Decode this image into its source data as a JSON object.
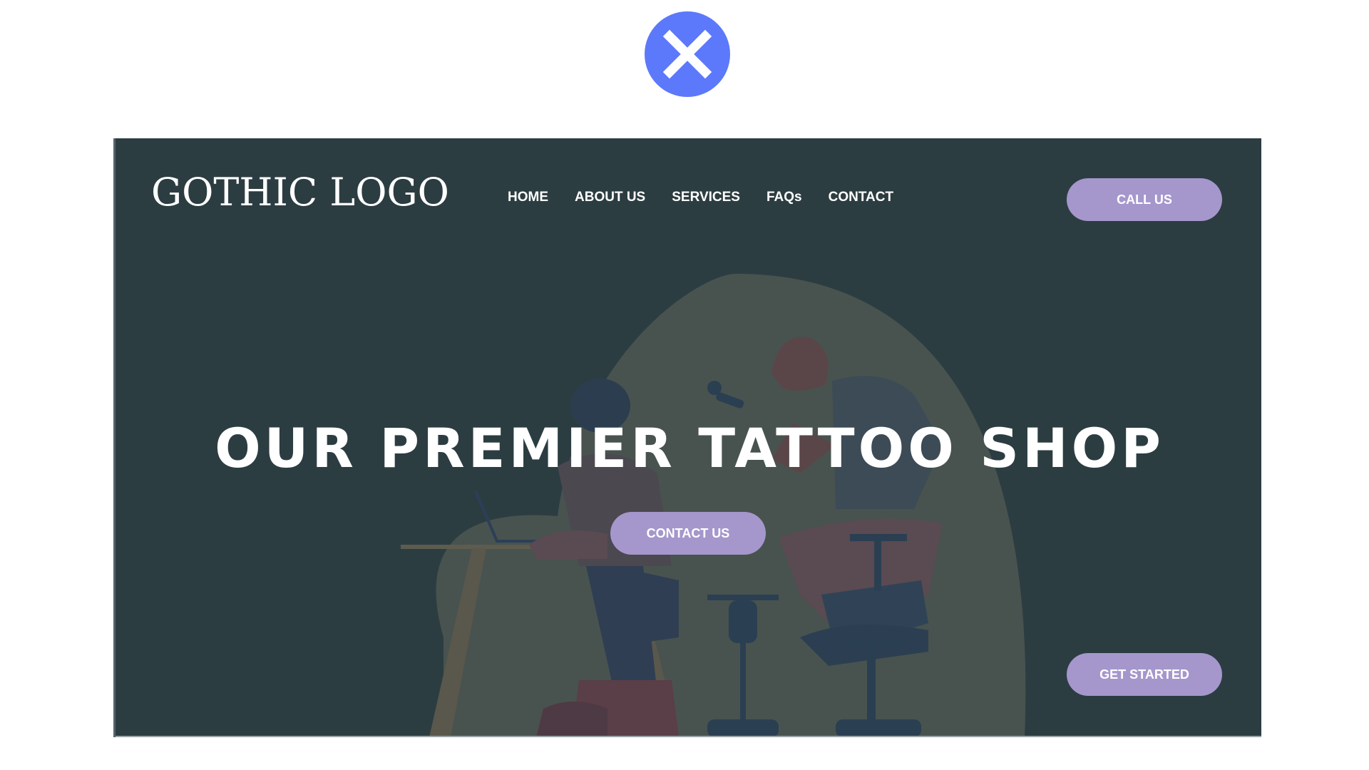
{
  "modal": {
    "close_icon": "close-icon",
    "close_color": "#5c79fb"
  },
  "site": {
    "logo": "GOTHIC LOGO",
    "nav": [
      "HOME",
      "ABOUT US",
      "SERVICES",
      "FAQs",
      "CONTACT"
    ],
    "call_label": "CALL US",
    "headline": "OUR PREMIER TATTOO SHOP",
    "contact_label": "CONTACT US",
    "start_label": "GET STARTED",
    "background_color": "#2c3d42",
    "accent_color": "#a597cc"
  }
}
